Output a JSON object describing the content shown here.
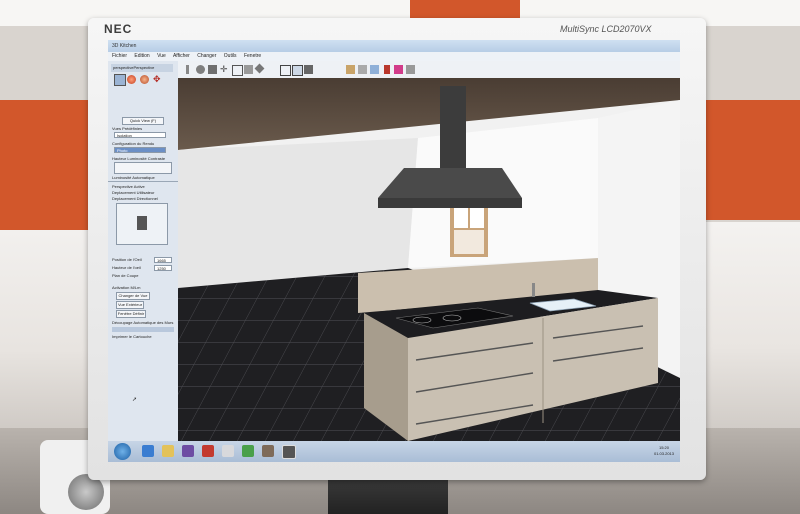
{
  "monitor": {
    "brand": "NEC",
    "model": "MultiSync LCD2070VX"
  },
  "app": {
    "title": "3D Kitchen",
    "menu": [
      "Fichier",
      "Edition",
      "Vue",
      "Afficher",
      "Changer",
      "Outils",
      "Fenetre"
    ],
    "view_tab": "perspectivePerspective",
    "sidebar": {
      "quick_view_button": "Quick View (F)",
      "section_predefined": "Vues Prédéfinies",
      "predefined_value": "Isolation",
      "section_config": "Configuration du Rendu",
      "config_value": "Photo",
      "section_height": "Hauteur Luminosité Contraste",
      "auto_light": "Luminosité Automatique",
      "perspective_active": "Perspective Active",
      "move_mode_user": "Deplacement Utilisateur",
      "move_mode_direct": "Deplacement Directionnel",
      "fov_label": "Position de l'Oeil",
      "fov_value": "1665",
      "height_label": "Hauteur de l'oeil",
      "height_value": "1250",
      "cut_label": "Plan de Coupe",
      "activation": "Activation M/Lm",
      "change_view": "Changer de Vue",
      "view_exterior": "Vue Extérieur",
      "frame_option": "Fenêtre Définir",
      "auto_cut": "Découpage Automatique des Murs",
      "cartouche": "Imprimer le Cartouche"
    },
    "clock": {
      "time": "15:20",
      "date": "01.03.2013"
    }
  },
  "colors": {
    "accent": "#d2572b",
    "floor": "#1f1f22",
    "counter": "#c9c0b2",
    "worktop": "#222226"
  }
}
